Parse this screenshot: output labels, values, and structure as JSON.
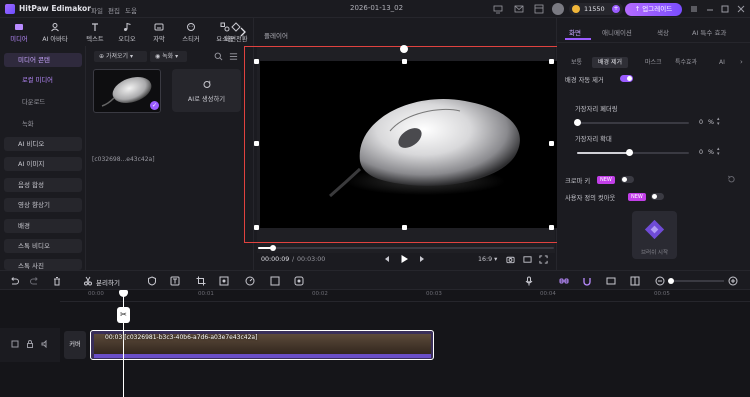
{
  "app": {
    "name": "HitPaw Edimakor",
    "menus": [
      "파일",
      "편집",
      "도움"
    ],
    "doc_title": "2026-01-13_02",
    "credits": "11550",
    "upgrade_label": "↑ 업그레이드"
  },
  "tools": [
    {
      "label": "미디어",
      "icon": "media-icon"
    },
    {
      "label": "AI 아바타",
      "icon": "avatar-icon"
    },
    {
      "label": "텍스트",
      "icon": "text-icon"
    },
    {
      "label": "오디오",
      "icon": "audio-icon"
    },
    {
      "label": "자막",
      "icon": "subtitle-icon"
    },
    {
      "label": "스티커",
      "icon": "sticker-icon"
    },
    {
      "label": "요소들",
      "icon": "elements-icon"
    },
    {
      "label": "화면전환",
      "icon": "transition-icon"
    }
  ],
  "leftnav": {
    "groups": [
      "미디어 콘텐",
      "AI 비디오",
      "AI 이미지",
      "음성 합성",
      "영상 향상기",
      "배경",
      "스톡 비디오",
      "스톡 사진"
    ],
    "subs": [
      "로컬 미디어",
      "다운로드",
      "녹화"
    ]
  },
  "media": {
    "import_label": "가져오기",
    "record_label": "녹화",
    "thumb_name": "[c032698...e43c42a]",
    "ai_card_label": "AI로 생성하기"
  },
  "player": {
    "title": "플레이어",
    "current_time": "00:00:09",
    "total_time": "00:03:00",
    "aspect": "16:9"
  },
  "right": {
    "tabs": [
      "화면",
      "애니메이션",
      "색상",
      "AI 특수 효과"
    ],
    "subtabs": [
      "보통",
      "배경 제거",
      "마스크",
      "특수효과",
      "AI"
    ],
    "bg_auto_label": "배경 자동 제거",
    "edge_feather_label": "가장자리 페더링",
    "edge_feather_value": "0",
    "edge_expand_label": "가장자리 확대",
    "edge_expand_value": "0",
    "unit": "%",
    "chroma_label": "크로마 키",
    "chroma_new": "NEW",
    "cutout_label": "사용자 정의 컷아웃",
    "cutout_new": "NEW",
    "ai_start_label": "브러쉬 시작"
  },
  "timeline": {
    "split_label": "분리하기",
    "track_label": "커버",
    "ruler": [
      "00:00",
      "00:01",
      "00:02",
      "00:03",
      "00:04",
      "00:05"
    ],
    "clip_name": "00:03 [c0326981-b3c3-40b6-a7d6-a03e7e43c42a]"
  },
  "colors": {
    "accent": "#9b5cff",
    "selection": "#e0423f",
    "new_badge": "#c23fe8"
  },
  "playback_progress": 0.05
}
